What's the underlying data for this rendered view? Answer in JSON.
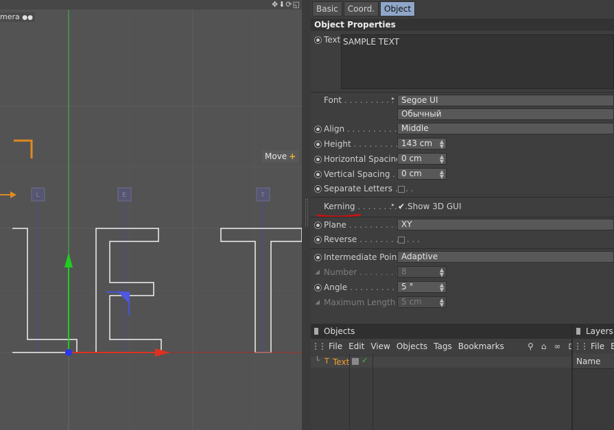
{
  "viewport": {
    "camera_label": "mera",
    "move_label": "Move",
    "text_shown": "LET",
    "gizmo_handle_labels": [
      "L",
      "E",
      "T"
    ]
  },
  "tabs": [
    {
      "label": "Basic",
      "active": false
    },
    {
      "label": "Coord.",
      "active": false
    },
    {
      "label": "Object",
      "active": true
    }
  ],
  "section_title": "Object Properties",
  "text_field": {
    "label": "Text",
    "value": "SAMPLE TEXT"
  },
  "font": {
    "label": "Font",
    "family": "Segoe UI",
    "style": "Обычный"
  },
  "align": {
    "label": "Align",
    "value": "Middle"
  },
  "height": {
    "label": "Height",
    "value": "143 cm"
  },
  "horizontal_spacing": {
    "label": "Horizontal Spacing",
    "value": "0 cm"
  },
  "vertical_spacing": {
    "label": "Vertical Spacing",
    "value": "0 cm"
  },
  "separate_letters": {
    "label": "Separate Letters",
    "checked": false
  },
  "kerning": {
    "label": "Kerning",
    "show3d_label": "Show 3D GUI",
    "show3d_checked": true
  },
  "plane": {
    "label": "Plane",
    "value": "XY"
  },
  "reverse": {
    "label": "Reverse",
    "checked": false
  },
  "intermediate_points": {
    "label": "Intermediate Points",
    "value": "Adaptive"
  },
  "number": {
    "label": "Number",
    "value": "8"
  },
  "angle": {
    "label": "Angle",
    "value": "5 °"
  },
  "max_length": {
    "label": "Maximum Length",
    "value": "5 cm"
  },
  "objects_panel": {
    "title": "Objects",
    "menu": [
      "File",
      "Edit",
      "View",
      "Objects",
      "Tags",
      "Bookmarks"
    ],
    "object_name": "Text"
  },
  "layers_panel": {
    "title": "Layers",
    "menu": [
      "File",
      "Ec"
    ],
    "column_name": "Name"
  },
  "colors": {
    "active_tab": "#8fa6c8",
    "object_name": "#f0a030",
    "axis_x": "#e03020",
    "axis_y": "#20c020",
    "kerning_underline": "#d01010"
  }
}
